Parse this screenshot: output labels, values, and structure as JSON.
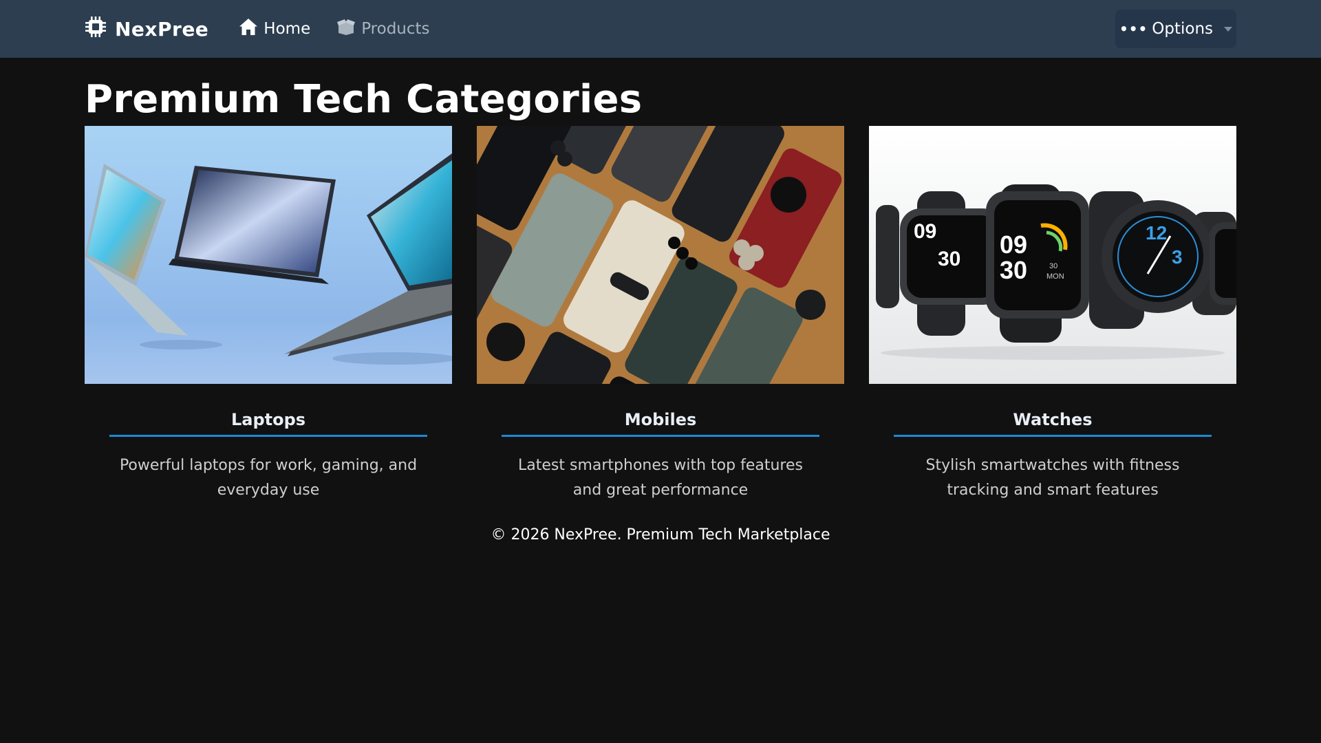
{
  "nav": {
    "brand": "NexPree",
    "home_label": "Home",
    "products_label": "Products",
    "options_label": "Options",
    "options_dots": "•••"
  },
  "main": {
    "title": "Premium Tech Categories",
    "categories": [
      {
        "title": "Laptops",
        "description": "Powerful laptops for work, gaming, and everyday use"
      },
      {
        "title": "Mobiles",
        "description": "Latest smartphones with top features and great performance"
      },
      {
        "title": "Watches",
        "description": "Stylish smartwatches with fitness tracking and smart features"
      }
    ]
  },
  "footer": {
    "text": "© 2026 NexPree. Premium Tech Marketplace"
  },
  "watch_faces": [
    {
      "h": "09",
      "m": "30"
    },
    {
      "h": "09",
      "m": "30",
      "sub": "30",
      "day": "MON"
    },
    {
      "h": "12",
      "m": "3"
    }
  ],
  "colors": {
    "navbar": "#2c3e50",
    "background": "#111111",
    "accent": "#1a8ad6",
    "muted_link": "#a9b4bf"
  },
  "icons": {
    "brand": "microchip-icon",
    "home": "house-icon",
    "products": "box-icon",
    "options_caret": "caret-down-icon"
  }
}
